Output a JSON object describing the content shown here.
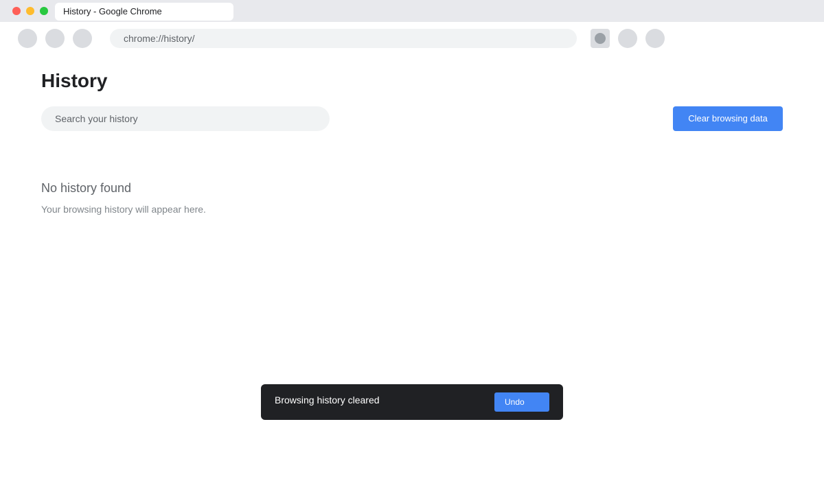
{
  "window": {
    "tab_title": "History - Google Chrome"
  },
  "toolbar": {
    "url": "chrome://history/"
  },
  "page": {
    "title": "History",
    "search_placeholder": "Search your history",
    "clear_button_label": "Clear browsing data",
    "empty_title": "No history found",
    "empty_subtitle": "Your browsing history will appear here."
  },
  "snackbar": {
    "message": "Browsing history cleared",
    "undo_label": "Undo"
  },
  "colors": {
    "accent": "#4285f4",
    "snackbar_bg": "#202124",
    "titlebar_bg": "#e8e9ed"
  }
}
